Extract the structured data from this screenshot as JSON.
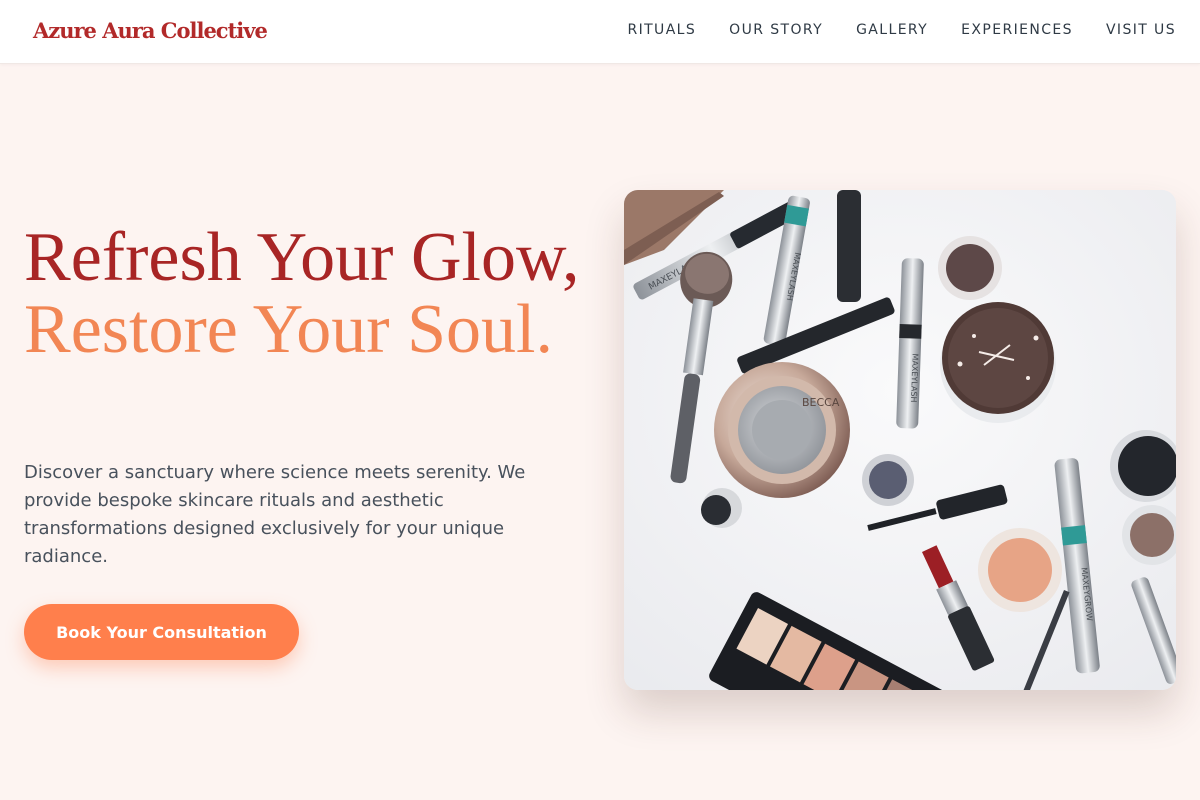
{
  "header": {
    "logo": "Azure Aura Collective",
    "nav": [
      {
        "label": "RITUALS"
      },
      {
        "label": "OUR STORY"
      },
      {
        "label": "GALLERY"
      },
      {
        "label": "EXPERIENCES"
      },
      {
        "label": "VISIT US"
      }
    ]
  },
  "hero": {
    "headline_line1": "Refresh Your Glow,",
    "headline_line2": "Restore Your Soul.",
    "description": "Discover a sanctuary where science meets serenity. We provide bespoke skincare rituals and aesthetic transformations designed exclusively for your unique radiance.",
    "cta_label": "Book Your Consultation",
    "image": {
      "subject": "flat-lay of makeup products: mascaras, brush, compact, eyeshadow palette, lipstick, loose powders",
      "product_labels": [
        "MAXEYLASH",
        "MAXEYGROW",
        "BECCA"
      ]
    }
  },
  "colors": {
    "background": "#fdf4f1",
    "brand_red": "#a82525",
    "accent_coral": "#f28654",
    "cta": "#ff7f4c",
    "nav_text": "#2f3a45",
    "body_text": "#48515c"
  }
}
